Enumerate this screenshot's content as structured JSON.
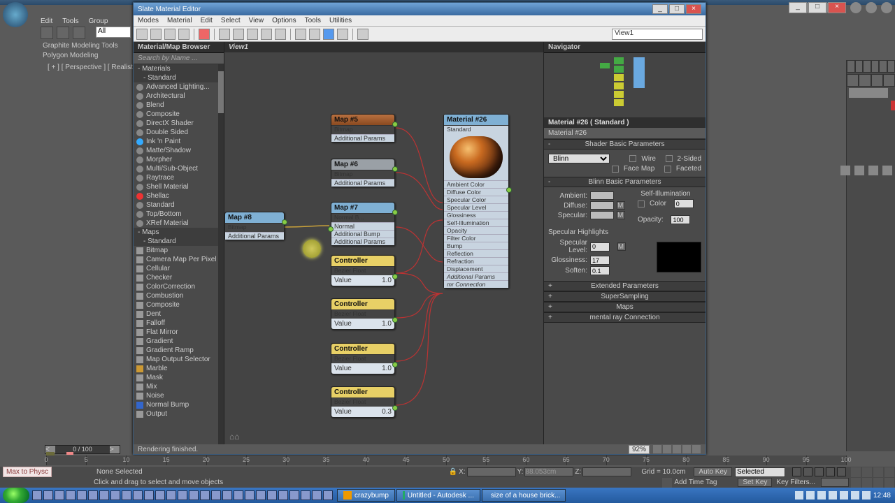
{
  "host": {
    "menu": [
      "Edit",
      "Tools",
      "Group"
    ],
    "ribbon_dropdown": "All",
    "ribbon_tab": "Graphite Modeling Tools",
    "ribbon_sub": "Polygon Modeling",
    "viewport_label": "[ + ] [ Perspective ] [ Realistic + Edg",
    "time_slider": "0 / 100",
    "status_none": "None Selected",
    "status_hint": "Click and drag to select and move objects",
    "max_to_physc": "Max to Physc",
    "grid": "Grid = 10.0cm",
    "add_time_tag": "Add Time Tag",
    "auto_key": "Auto Key",
    "set_key": "Set Key",
    "selected": "Selected",
    "key_filters": "Key Filters...",
    "coords": {
      "x": "X:",
      "y": "Y:",
      "z": "Z:",
      "yval": "88.053cm"
    },
    "ticks": [
      "0",
      "5",
      "10",
      "15",
      "20",
      "25",
      "30",
      "35",
      "40",
      "45",
      "50",
      "55",
      "60",
      "65",
      "70",
      "75",
      "80",
      "85",
      "90",
      "95",
      "100"
    ]
  },
  "slate": {
    "title": "Slate Material Editor",
    "menu": [
      "Modes",
      "Material",
      "Edit",
      "Select",
      "View",
      "Options",
      "Tools",
      "Utilities"
    ],
    "view_dd": "View1",
    "view_tab": "View1",
    "browser_hd": "Material/Map Browser",
    "search": "Search by Name ...",
    "status": "Rendering finished.",
    "zoom": "92%",
    "navigator": "Navigator",
    "tree": {
      "materials": "- Materials",
      "standard": "- Standard",
      "mats": [
        "Advanced Lighting...",
        "Architectural",
        "Blend",
        "Composite",
        "DirectX Shader",
        "Double Sided",
        "Ink 'n Paint",
        "Matte/Shadow",
        "Morpher",
        "Multi/Sub-Object",
        "Raytrace",
        "Shell Material",
        "Shellac",
        "Standard",
        "Top/Bottom",
        "XRef Material"
      ],
      "maps": "- Maps",
      "standard2": "- Standard",
      "mapitems": [
        "Bitmap",
        "Camera Map Per Pixel",
        "Cellular",
        "Checker",
        "ColorCorrection",
        "Combustion",
        "Composite",
        "Dent",
        "Falloff",
        "Flat Mirror",
        "Gradient",
        "Gradient Ramp",
        "Map Output Selector",
        "Marble",
        "Mask",
        "Mix",
        "Noise",
        "Normal Bump",
        "Output"
      ]
    }
  },
  "nodes": {
    "map8": {
      "t1": "Map #8",
      "t2": "Bitmap",
      "extra": "Additional Params"
    },
    "map5": {
      "t1": "Map #5",
      "t2": "Bitmap",
      "extra": "Additional Params"
    },
    "map6": {
      "t1": "Map #6",
      "t2": "Bitmap",
      "extra": "Additional Params"
    },
    "map7": {
      "t1": "Map #7",
      "t2": "Normal  B...",
      "rows": [
        "Normal",
        "Additional Bump",
        "Additional Params"
      ]
    },
    "c1": {
      "t1": "Controller",
      "t2": "Bezier Float",
      "lab": "Value",
      "val": "1.0"
    },
    "c2": {
      "t1": "Controller",
      "t2": "Bezier Float",
      "lab": "Value",
      "val": "1.0"
    },
    "c3": {
      "t1": "Controller",
      "t2": "Bezier Float",
      "lab": "Value",
      "val": "1.0"
    },
    "c4": {
      "t1": "Controller",
      "t2": "Bezier Float",
      "lab": "Value",
      "val": "0.3"
    },
    "mat": {
      "t1": "Material #26",
      "t2": "Standard",
      "slots": [
        "Ambient Color",
        "Diffuse Color",
        "Specular Color",
        "Specular Level",
        "Glossiness",
        "Self-Illumination",
        "Opacity",
        "Filter Color",
        "Bump",
        "Reflection",
        "Refraction",
        "Displacement",
        "Additional Params",
        "mr Connection"
      ]
    }
  },
  "props": {
    "hd": "Material #26  ( Standard )",
    "name": "Material #26",
    "sec_shader": "Shader Basic Parameters",
    "shader": "Blinn",
    "wire": "Wire",
    "twosided": "2-Sided",
    "facemap": "Face Map",
    "faceted": "Faceted",
    "sec_blinn": "Blinn Basic Parameters",
    "selfillum": "Self-Illumination",
    "ambient": "Ambient:",
    "diffuse": "Diffuse:",
    "specular": "Specular:",
    "color": "Color",
    "colorv": "0",
    "opacity": "Opacity:",
    "opv": "100",
    "spec_hl": "Specular Highlights",
    "speclevel": "Specular Level:",
    "speclv": "0",
    "gloss": "Glossiness:",
    "glossv": "17",
    "soften": "Soften:",
    "softenv": "0.1",
    "m": "M",
    "rollouts": [
      "Extended Parameters",
      "SuperSampling",
      "Maps",
      "mental ray Connection"
    ]
  },
  "taskbar": {
    "tasks": [
      "crazybump",
      "Untitled - Autodesk ...",
      "size of a house brick..."
    ],
    "clock": "12:48"
  }
}
